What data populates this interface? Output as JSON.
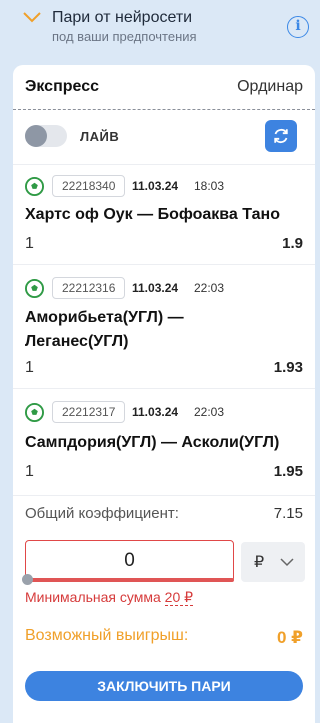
{
  "header": {
    "title": "Пари от нейросети",
    "subtitle": "под ваши предпочтения",
    "info_glyph": "i"
  },
  "tabs": {
    "express": "Экспресс",
    "ordinar": "Ординар"
  },
  "live": {
    "label": "ЛАЙВ",
    "enabled": false
  },
  "bets": [
    {
      "code": "22218340",
      "date": "11.03.24",
      "time": "18:03",
      "match": "Хартс оф Оук — Бофоаква Тано",
      "outcome": "1",
      "coef": "1.9"
    },
    {
      "code": "22212316",
      "date": "11.03.24",
      "time": "22:03",
      "match": "Аморибьета(УГЛ) — Леганес(УГЛ)",
      "outcome": "1",
      "coef": "1.93"
    },
    {
      "code": "22212317",
      "date": "11.03.24",
      "time": "22:03",
      "match": "Сампдория(УГЛ) — Асколи(УГЛ)",
      "outcome": "1",
      "coef": "1.95"
    }
  ],
  "total": {
    "label": "Общий коэффициент:",
    "value": "7.15"
  },
  "stake": {
    "value": "0",
    "currency": "₽",
    "min_text": "Минимальная сумма",
    "min_amount": "20 ₽"
  },
  "win": {
    "label": "Возможный выигрыш:",
    "value": "0 ₽"
  },
  "submit_label": "ЗАКЛЮЧИТЬ ПАРИ",
  "colors": {
    "accent": "#3d83e0",
    "error": "#e04848",
    "win": "#f0a02a",
    "background": "#dbe8f6"
  }
}
